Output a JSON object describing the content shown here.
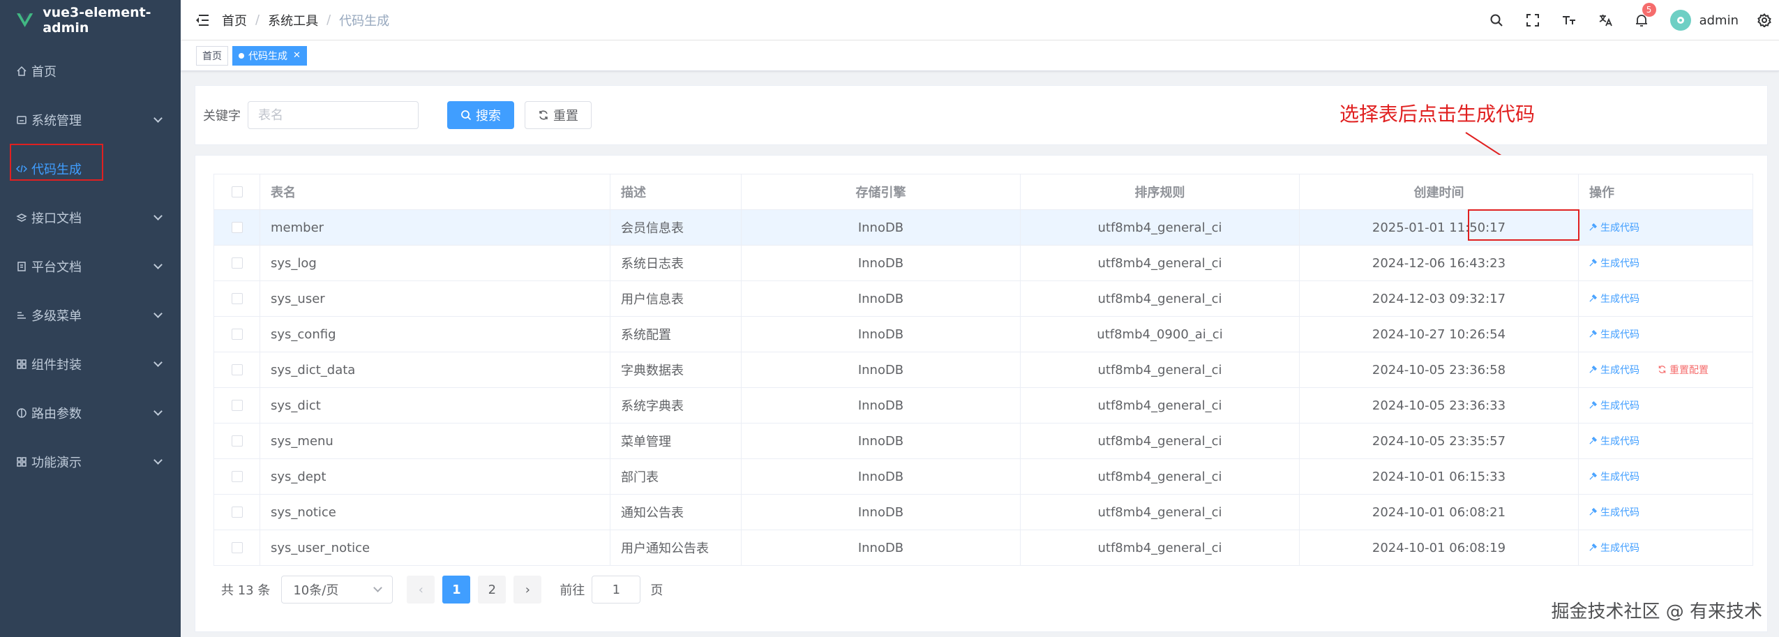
{
  "app": {
    "title": "vue3-element-admin"
  },
  "sidebar": {
    "items": [
      {
        "label": "首页",
        "icon": "home-icon",
        "has_children": false,
        "active": false
      },
      {
        "label": "系统管理",
        "icon": "system-icon",
        "has_children": true,
        "active": false
      },
      {
        "label": "代码生成",
        "icon": "code-icon",
        "has_children": false,
        "active": true
      },
      {
        "label": "接口文档",
        "icon": "api-icon",
        "has_children": true,
        "active": false
      },
      {
        "label": "平台文档",
        "icon": "document-icon",
        "has_children": true,
        "active": false
      },
      {
        "label": "多级菜单",
        "icon": "menu-icon",
        "has_children": true,
        "active": false
      },
      {
        "label": "组件封装",
        "icon": "component-icon",
        "has_children": true,
        "active": false
      },
      {
        "label": "路由参数",
        "icon": "route-icon",
        "has_children": true,
        "active": false
      },
      {
        "label": "功能演示",
        "icon": "demo-icon",
        "has_children": true,
        "active": false
      }
    ]
  },
  "header": {
    "breadcrumb": [
      "首页",
      "系统工具",
      "代码生成"
    ],
    "notification_count": "5",
    "username": "admin"
  },
  "tags": [
    {
      "label": "首页",
      "active": false
    },
    {
      "label": "代码生成",
      "active": true
    }
  ],
  "search": {
    "label": "关键字",
    "placeholder": "表名",
    "value": "",
    "search_button": "搜索",
    "reset_button": "重置"
  },
  "annotation": "选择表后点击生成代码",
  "table": {
    "columns": [
      "表名",
      "描述",
      "存储引擎",
      "排序规则",
      "创建时间",
      "操作"
    ],
    "rows": [
      {
        "name": "member",
        "desc": "会员信息表",
        "engine": "InnoDB",
        "collation": "utf8mb4_general_ci",
        "created": "2025-01-01 11:50:17",
        "actions": [
          "生成代码"
        ]
      },
      {
        "name": "sys_log",
        "desc": "系统日志表",
        "engine": "InnoDB",
        "collation": "utf8mb4_general_ci",
        "created": "2024-12-06 16:43:23",
        "actions": [
          "生成代码"
        ]
      },
      {
        "name": "sys_user",
        "desc": "用户信息表",
        "engine": "InnoDB",
        "collation": "utf8mb4_general_ci",
        "created": "2024-12-03 09:32:17",
        "actions": [
          "生成代码"
        ]
      },
      {
        "name": "sys_config",
        "desc": "系统配置",
        "engine": "InnoDB",
        "collation": "utf8mb4_0900_ai_ci",
        "created": "2024-10-27 10:26:54",
        "actions": [
          "生成代码"
        ]
      },
      {
        "name": "sys_dict_data",
        "desc": "字典数据表",
        "engine": "InnoDB",
        "collation": "utf8mb4_general_ci",
        "created": "2024-10-05 23:36:58",
        "actions": [
          "生成代码",
          "重置配置"
        ]
      },
      {
        "name": "sys_dict",
        "desc": "系统字典表",
        "engine": "InnoDB",
        "collation": "utf8mb4_general_ci",
        "created": "2024-10-05 23:36:33",
        "actions": [
          "生成代码"
        ]
      },
      {
        "name": "sys_menu",
        "desc": "菜单管理",
        "engine": "InnoDB",
        "collation": "utf8mb4_general_ci",
        "created": "2024-10-05 23:35:57",
        "actions": [
          "生成代码"
        ]
      },
      {
        "name": "sys_dept",
        "desc": "部门表",
        "engine": "InnoDB",
        "collation": "utf8mb4_general_ci",
        "created": "2024-10-01 06:15:33",
        "actions": [
          "生成代码"
        ]
      },
      {
        "name": "sys_notice",
        "desc": "通知公告表",
        "engine": "InnoDB",
        "collation": "utf8mb4_general_ci",
        "created": "2024-10-01 06:08:21",
        "actions": [
          "生成代码"
        ]
      },
      {
        "name": "sys_user_notice",
        "desc": "用户通知公告表",
        "engine": "InnoDB",
        "collation": "utf8mb4_general_ci",
        "created": "2024-10-01 06:08:19",
        "actions": [
          "生成代码"
        ]
      }
    ]
  },
  "pagination": {
    "total": "共 13 条",
    "page_size": "10条/页",
    "pages": [
      "1",
      "2"
    ],
    "current": "1",
    "goto_label": "前往",
    "goto_value": "1",
    "goto_suffix": "页"
  },
  "watermark": "掘金技术社区 @ 有来技术",
  "colors": {
    "primary": "#409eff",
    "sidebar_bg": "#304156",
    "danger": "#f56c6c",
    "annotation": "#e02020"
  }
}
